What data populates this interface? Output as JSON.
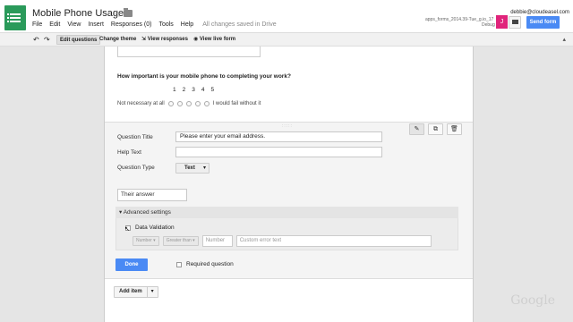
{
  "header": {
    "title": "Mobile Phone Usage",
    "menu": [
      "File",
      "Edit",
      "View",
      "Insert",
      "Responses (0)",
      "Tools",
      "Help"
    ],
    "saved_status": "All changes saved in Drive",
    "user_email": "debbie@cloudeasel.com",
    "file_info": "apps_forms_2014.39-Tue_g.io_17",
    "debug_label": "Debug",
    "avatar_letter": "J",
    "send_label": "Send form"
  },
  "toolbar": {
    "edit_questions": "Edit questions",
    "change_theme": "Change theme",
    "view_responses": "View responses",
    "view_live": "View live form"
  },
  "form": {
    "scale_question": "How important is your mobile phone to completing your work?",
    "scale_numbers": [
      "1",
      "2",
      "3",
      "4",
      "5"
    ],
    "scale_low": "Not necessary at all",
    "scale_high": "I would fail without it",
    "editor": {
      "question_title_label": "Question Title",
      "question_title_value": "Please enter your email address.",
      "help_text_label": "Help Text",
      "help_text_value": "",
      "question_type_label": "Question Type",
      "question_type_value": "Text",
      "answer_preview": "Their answer",
      "advanced_label": "Advanced settings",
      "data_validation_label": "Data Validation",
      "dv_type": "Number",
      "dv_condition": "Greater than",
      "dv_number_placeholder": "Number",
      "dv_error_placeholder": "Custom error text",
      "done_label": "Done",
      "required_label": "Required question"
    },
    "add_item_label": "Add item"
  },
  "watermark": "Google",
  "colors": {
    "brand_green": "#2a9a5a",
    "accent_blue": "#4a8af4",
    "avatar_pink": "#e0247b"
  }
}
